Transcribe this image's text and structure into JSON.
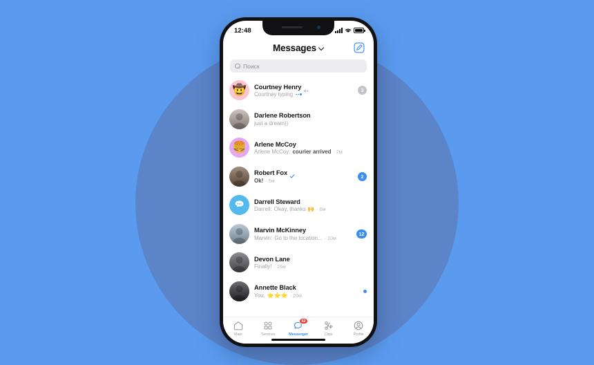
{
  "background": {
    "page_color": "#5b9bef",
    "circle_color": "#5c82c6"
  },
  "status_bar": {
    "time": "12:48",
    "icons": [
      "signal-bars-icon",
      "wifi-icon",
      "battery-icon"
    ]
  },
  "header": {
    "title": "Messages",
    "chevron": "chevron-down-icon",
    "compose_icon": "compose-icon"
  },
  "search": {
    "placeholder": "Поиск",
    "icon": "search-icon"
  },
  "chats": [
    {
      "name": "Courtney Henry",
      "muted": true,
      "verified": false,
      "avatar_type": "emoji",
      "avatar_emoji": "🤠",
      "avatar_bg": "#f9c6d2",
      "prefix": "",
      "snippet": "Courtney typing",
      "snippet_bold": false,
      "typing": true,
      "time": "",
      "badge": "3",
      "badge_style": "gray",
      "unread_dot": false
    },
    {
      "name": "Darlene Robertson",
      "muted": false,
      "verified": false,
      "avatar_type": "photo",
      "avatar_bg": "#b9a9a0",
      "prefix": "",
      "snippet": "just a dream))",
      "snippet_bold": false,
      "typing": false,
      "time": "",
      "badge": "",
      "badge_style": "",
      "unread_dot": false
    },
    {
      "name": "Arlene McCoy",
      "muted": false,
      "verified": false,
      "avatar_type": "emoji",
      "avatar_emoji": "🍔",
      "avatar_bg": "#e3a8f0",
      "prefix": "Arlene McCoy:",
      "snippet": "courier arrived",
      "snippet_bold": true,
      "typing": false,
      "time": "2м",
      "badge": "",
      "badge_style": "",
      "unread_dot": false
    },
    {
      "name": "Robert Fox",
      "muted": false,
      "verified": true,
      "avatar_type": "photo",
      "avatar_bg": "#7a5f4a",
      "prefix": "",
      "snippet": "Ok!",
      "snippet_bold": true,
      "typing": false,
      "time": "5м",
      "badge": "2",
      "badge_style": "blue",
      "unread_dot": false
    },
    {
      "name": "Darrell Steward",
      "muted": false,
      "verified": false,
      "avatar_type": "group",
      "avatar_bg": "#54b9ec",
      "prefix": "Darrell:",
      "snippet": "Okay, thanks 🙌",
      "snippet_bold": false,
      "typing": false,
      "time": "6м",
      "badge": "",
      "badge_style": "",
      "unread_dot": false
    },
    {
      "name": "Marvin McKinney",
      "muted": false,
      "verified": false,
      "avatar_type": "photo",
      "avatar_bg": "#9db4c6",
      "prefix": "Marvin:",
      "snippet": "Go to the location...",
      "snippet_bold": false,
      "typing": false,
      "time": "10м",
      "badge": "12",
      "badge_style": "blue",
      "unread_dot": false
    },
    {
      "name": "Devon Lane",
      "muted": false,
      "verified": false,
      "avatar_type": "photo",
      "avatar_bg": "#5d5d63",
      "prefix": "",
      "snippet": "Finally!",
      "snippet_bold": false,
      "typing": false,
      "time": "16м",
      "badge": "",
      "badge_style": "",
      "unread_dot": false
    },
    {
      "name": "Annette Black",
      "muted": false,
      "verified": false,
      "avatar_type": "photo",
      "avatar_bg": "#2e2e33",
      "prefix": "You:",
      "snippet": "⭐⭐⭐",
      "snippet_bold": false,
      "typing": false,
      "time": "20м",
      "badge": "",
      "badge_style": "",
      "unread_dot": true
    }
  ],
  "tabbar": {
    "items": [
      {
        "label": "Main",
        "icon": "home-icon",
        "active": false,
        "badge": ""
      },
      {
        "label": "Services",
        "icon": "grid-icon",
        "active": false,
        "badge": ""
      },
      {
        "label": "Messenger",
        "icon": "chat-bubble-icon",
        "active": true,
        "badge": "52"
      },
      {
        "label": "Clips",
        "icon": "clips-icon",
        "active": false,
        "badge": ""
      },
      {
        "label": "Profile",
        "icon": "profile-icon",
        "active": false,
        "badge": ""
      }
    ],
    "active_color": "#3a8ef0",
    "badge_color": "#ef3a3a"
  }
}
